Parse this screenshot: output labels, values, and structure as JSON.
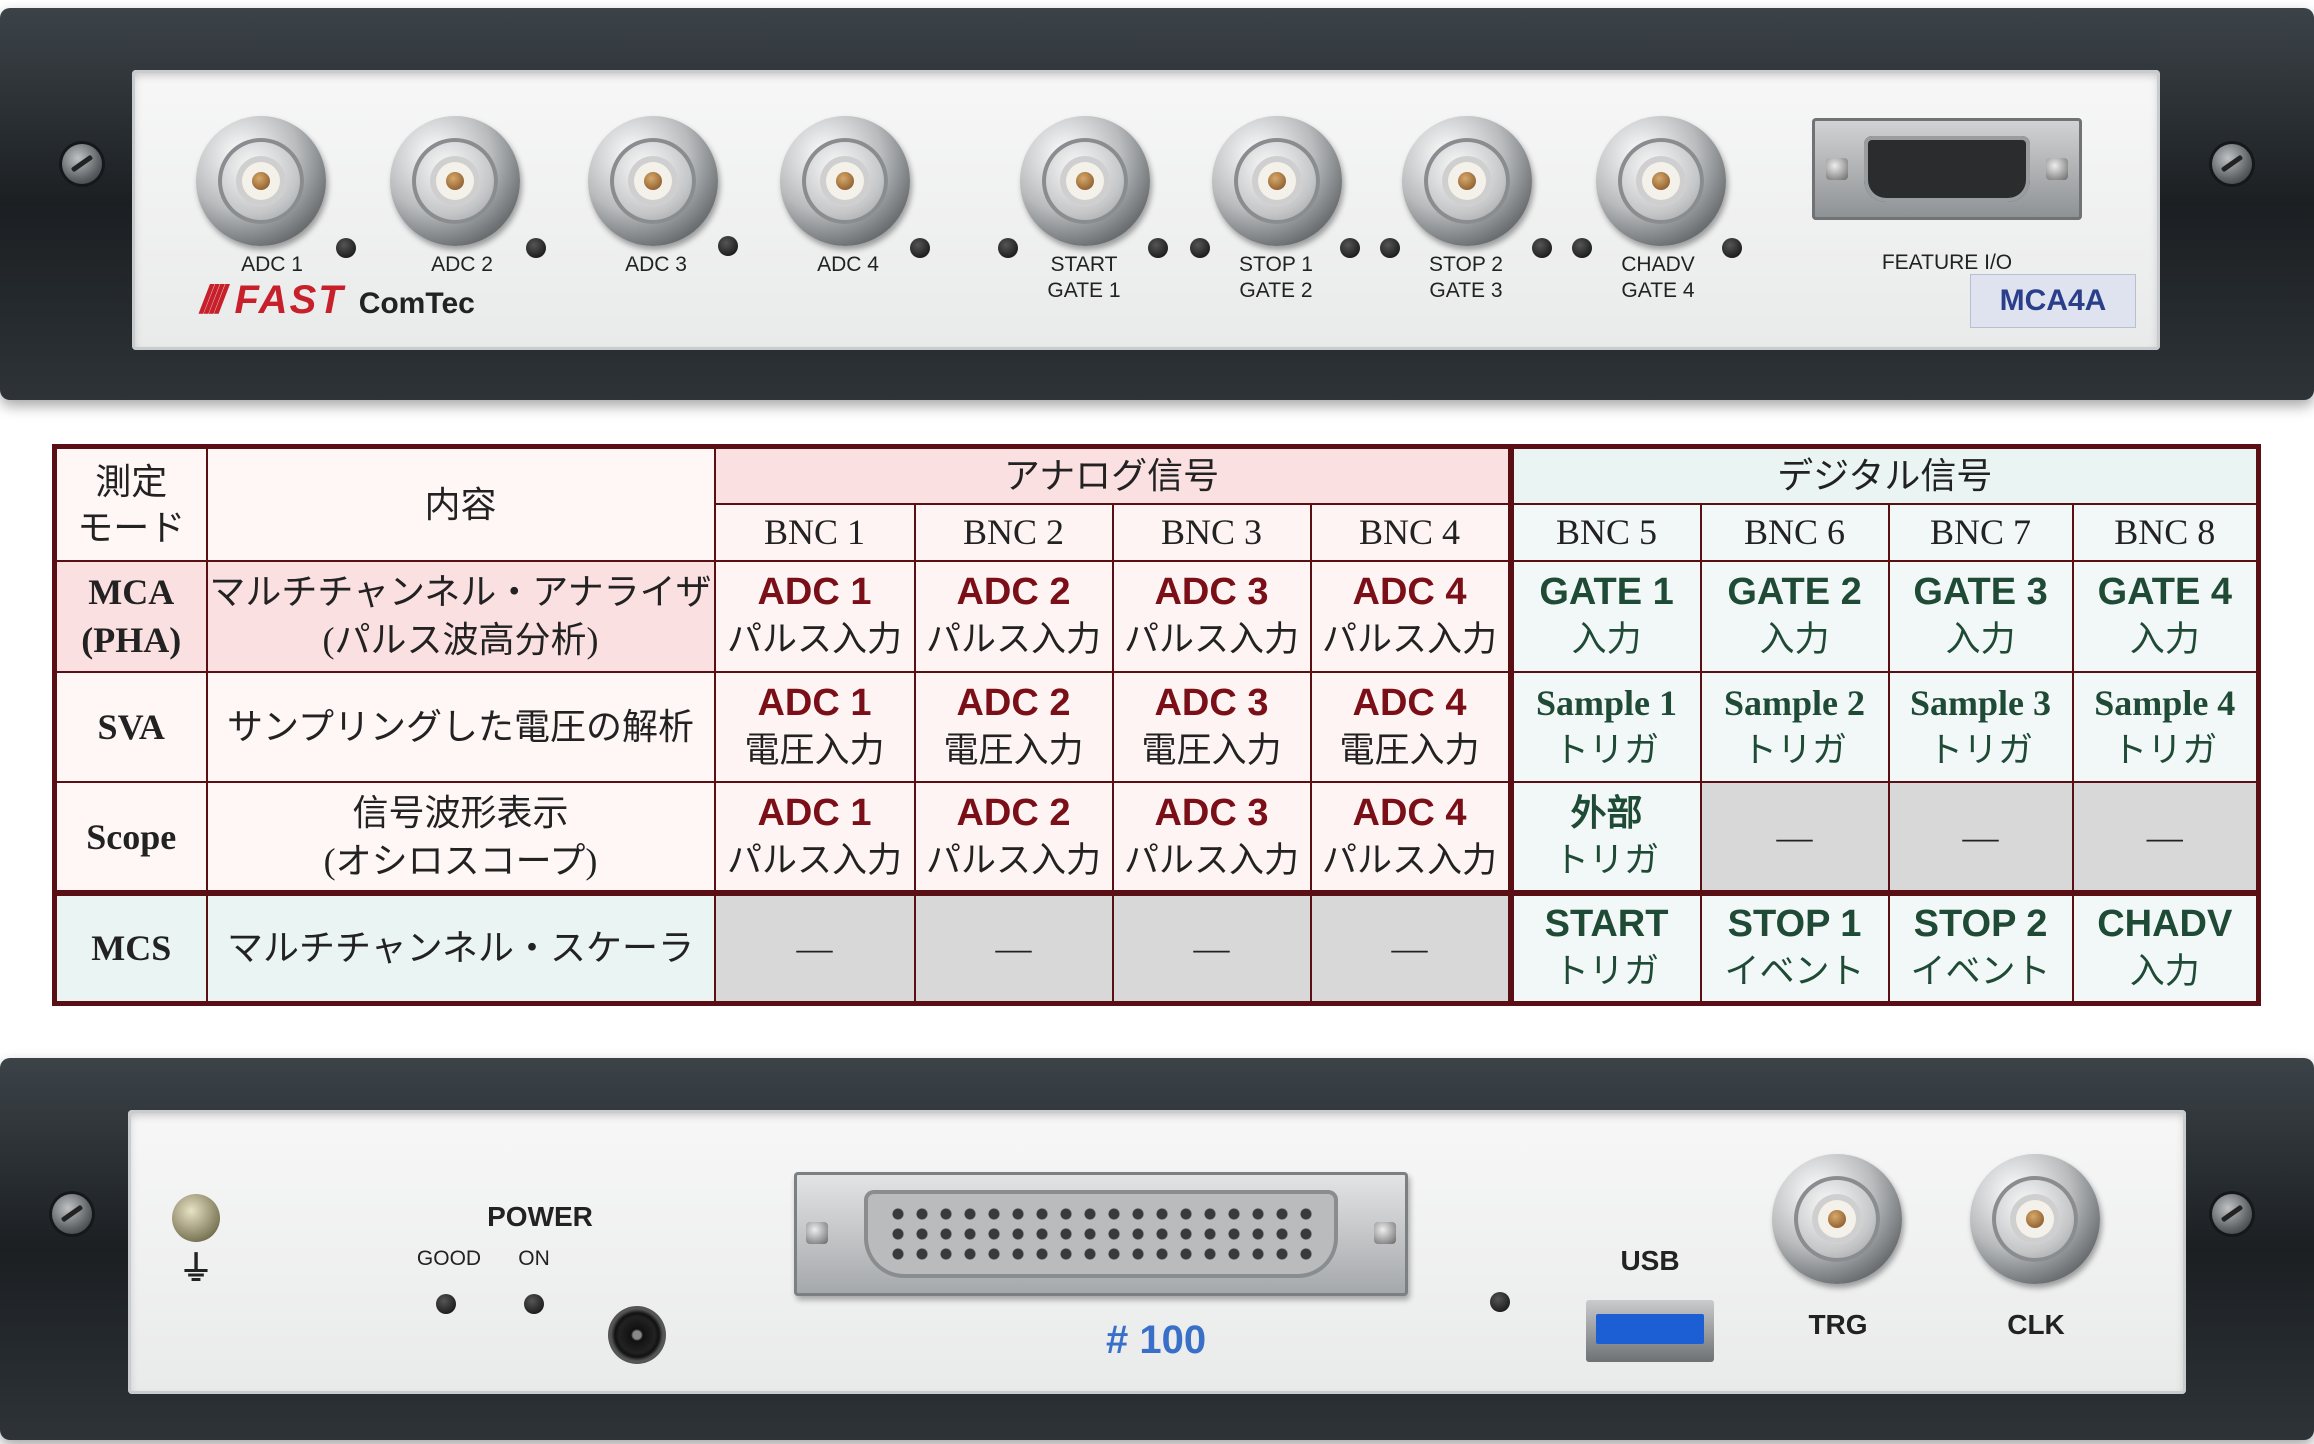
{
  "front_panel": {
    "inputs": [
      {
        "line1": "ADC 1",
        "line2": ""
      },
      {
        "line1": "ADC 2",
        "line2": ""
      },
      {
        "line1": "ADC 3",
        "line2": ""
      },
      {
        "line1": "ADC 4",
        "line2": ""
      },
      {
        "line1": "START",
        "line2": "GATE 1"
      },
      {
        "line1": "STOP 1",
        "line2": "GATE 2"
      },
      {
        "line1": "STOP 2",
        "line2": "GATE 3"
      },
      {
        "line1": "CHADV",
        "line2": "GATE 4"
      }
    ],
    "feature_io": "FEATURE I/O",
    "brand_stripes": "////",
    "brand_fast": "FAST",
    "brand_comtec": "ComTec",
    "model": "MCA4A"
  },
  "table": {
    "col_mode": "測定\nモード",
    "col_content": "内容",
    "group_analog": "アナログ信号",
    "group_digital": "デジタル信号",
    "bnc": [
      "BNC 1",
      "BNC 2",
      "BNC 3",
      "BNC 4",
      "BNC 5",
      "BNC 6",
      "BNC 7",
      "BNC 8"
    ],
    "rows": [
      {
        "mode": "MCA\n(PHA)",
        "desc": "マルチチャンネル・アナライザ\n(パルス波高分析)",
        "cells": [
          {
            "main": "ADC 1",
            "sub": "パルス入力"
          },
          {
            "main": "ADC 2",
            "sub": "パルス入力"
          },
          {
            "main": "ADC 3",
            "sub": "パルス入力"
          },
          {
            "main": "ADC 4",
            "sub": "パルス入力"
          },
          {
            "main": "GATE 1",
            "sub": "入力"
          },
          {
            "main": "GATE 2",
            "sub": "入力"
          },
          {
            "main": "GATE 3",
            "sub": "入力"
          },
          {
            "main": "GATE 4",
            "sub": "入力"
          }
        ]
      },
      {
        "mode": "SVA",
        "desc": "サンプリングした電圧の解析",
        "cells": [
          {
            "main": "ADC 1",
            "sub": "電圧入力"
          },
          {
            "main": "ADC 2",
            "sub": "電圧入力"
          },
          {
            "main": "ADC 3",
            "sub": "電圧入力"
          },
          {
            "main": "ADC 4",
            "sub": "電圧入力"
          },
          {
            "main": "Sample 1",
            "sub": "トリガ"
          },
          {
            "main": "Sample 2",
            "sub": "トリガ"
          },
          {
            "main": "Sample 3",
            "sub": "トリガ"
          },
          {
            "main": "Sample 4",
            "sub": "トリガ"
          }
        ]
      },
      {
        "mode": "Scope",
        "desc": "信号波形表示\n(オシロスコープ)",
        "cells": [
          {
            "main": "ADC 1",
            "sub": "パルス入力"
          },
          {
            "main": "ADC 2",
            "sub": "パルス入力"
          },
          {
            "main": "ADC 3",
            "sub": "パルス入力"
          },
          {
            "main": "ADC 4",
            "sub": "パルス入力"
          },
          {
            "main": "外部",
            "sub": "トリガ"
          },
          {
            "main": "—",
            "sub": ""
          },
          {
            "main": "—",
            "sub": ""
          },
          {
            "main": "—",
            "sub": ""
          }
        ]
      },
      {
        "mode": "MCS",
        "desc": "マルチチャンネル・スケーラ",
        "cells": [
          {
            "main": "—",
            "sub": ""
          },
          {
            "main": "—",
            "sub": ""
          },
          {
            "main": "—",
            "sub": ""
          },
          {
            "main": "—",
            "sub": ""
          },
          {
            "main": "START",
            "sub": "トリガ"
          },
          {
            "main": "STOP 1",
            "sub": "イベント"
          },
          {
            "main": "STOP 2",
            "sub": "イベント"
          },
          {
            "main": "CHADV",
            "sub": "入力"
          }
        ]
      }
    ]
  },
  "rear_panel": {
    "power_label": "POWER",
    "good_label": "GOOD",
    "on_label": "ON",
    "ground_symbol": "⏚",
    "serial": "# 100",
    "usb_label": "USB",
    "trg_label": "TRG",
    "clk_label": "CLK"
  },
  "colors": {
    "analog_text": "#7a0f18",
    "digital_text": "#1f4a36",
    "table_border": "#5a0f14",
    "brand_red": "#c8202a",
    "model_blue": "#2a3e8a",
    "serial_blue": "#3a6fc9",
    "usb_blue": "#1c5fd4"
  }
}
